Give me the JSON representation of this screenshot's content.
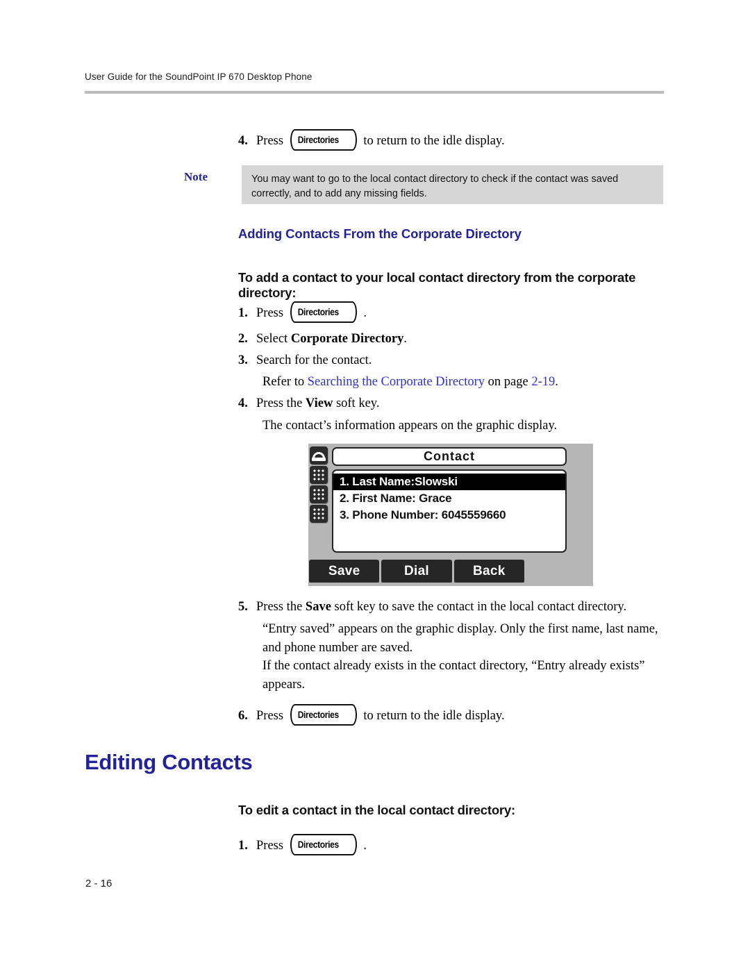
{
  "header": {
    "running_title": "User Guide for the SoundPoint IP 670 Desktop Phone"
  },
  "footer": {
    "page_number": "2 - 16"
  },
  "key_label": "Directories",
  "step4_top": {
    "number": "4.",
    "text_before": "Press",
    "text_after": "to return to the idle display."
  },
  "note": {
    "label": "Note",
    "text": "You may want to go to the local contact directory to check if the contact was saved correctly, and to add any missing fields."
  },
  "section": {
    "heading": "Adding Contacts From the Corporate Directory",
    "procedure_title": "To add a contact to your local contact directory from the corporate directory:"
  },
  "steps": {
    "s1": {
      "number": "1.",
      "text_before": "Press",
      "text_after": "."
    },
    "s2": {
      "number": "2.",
      "text_plain": "Select ",
      "text_bold": "Corporate Directory",
      "text_end": "."
    },
    "s3": {
      "number": "3.",
      "text": "Search for the contact."
    },
    "s3_ref": {
      "prefix": "Refer to ",
      "link": "Searching the Corporate Directory",
      "middle": " on page ",
      "page_link": "2-19",
      "suffix": "."
    },
    "s4": {
      "number": "4.",
      "text_plain": "Press the ",
      "text_bold": "View",
      "text_end": " soft key."
    },
    "s4_result": "The contact’s information appears on the graphic display.",
    "s5": {
      "number": "5.",
      "text_plain": "Press the ",
      "text_bold": "Save",
      "text_end": " soft key to save the contact in the local contact directory."
    },
    "s5_p1": "“Entry saved” appears on the graphic display. Only the first name, last name, and phone number are saved.",
    "s5_p2": "If the contact already exists in the contact directory, “Entry already exists” appears.",
    "s6": {
      "number": "6.",
      "text_before": "Press",
      "text_after": "to return to the idle display."
    }
  },
  "editing_section": {
    "heading": "Editing Contacts",
    "procedure_title": "To edit a contact in the local contact directory:",
    "step1": {
      "number": "1.",
      "text_before": "Press",
      "text_after": "."
    }
  },
  "lcd": {
    "title": "Contact",
    "rows": [
      "1. Last Name:Slowski",
      "2. First Name: Grace",
      "3. Phone Number: 6045559660"
    ],
    "selected_index": 0,
    "softkeys": [
      "Save",
      "Dial",
      "Back"
    ],
    "rail_icons": [
      "handset-icon",
      "keypad-icon",
      "keypad-icon",
      "keypad-icon"
    ]
  },
  "colors": {
    "heading_blue": "#22229b",
    "link_blue": "#2f2fd8",
    "note_background": "#d6d6d6",
    "rule_gray": "#bcbcbc"
  }
}
